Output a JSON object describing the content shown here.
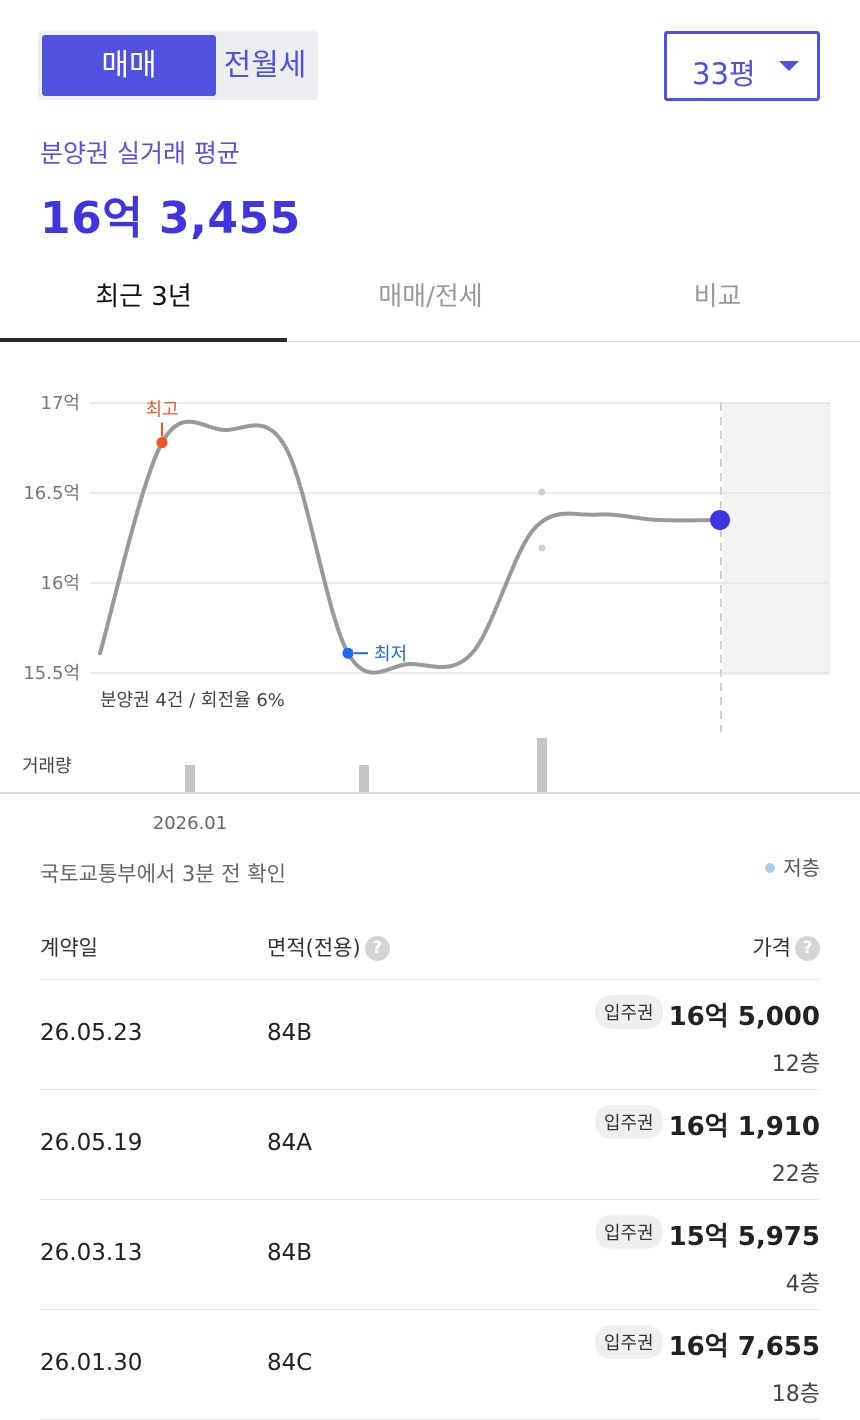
{
  "toggle": {
    "active": "매매",
    "inactive": "전월세"
  },
  "area_select": {
    "value": "33평"
  },
  "summary": {
    "subtitle": "분양권 실거래 평균",
    "average_price": "16억 3,455"
  },
  "tabs": [
    {
      "label": "최근 3년",
      "selected": true
    },
    {
      "label": "매매/전세",
      "selected": false
    },
    {
      "label": "비교",
      "selected": false
    }
  ],
  "chart_data": {
    "type": "line",
    "y_ticks": [
      "17억",
      "16.5억",
      "16억",
      "15.5억"
    ],
    "ylim": [
      15.5,
      17
    ],
    "y_unit": "억",
    "x_tick_labels": [
      "2026.01"
    ],
    "series": [
      {
        "points": [
          [
            0,
            15.61
          ],
          [
            1,
            16.78
          ],
          [
            2,
            16.85
          ],
          [
            3,
            16.75
          ],
          [
            4,
            15.61
          ],
          [
            5,
            15.55
          ],
          [
            6,
            15.61
          ],
          [
            7,
            16.3
          ],
          [
            8,
            16.38
          ],
          [
            9,
            16.35
          ],
          [
            10,
            16.35
          ]
        ]
      }
    ],
    "max_label": "최고",
    "max_value": 16.78,
    "min_label": "최저",
    "min_value": 15.61,
    "current_value": 16.35,
    "note": "분양권 4건 / 회전율 6%",
    "volume_label": "거래량",
    "volume": [
      1,
      1,
      2
    ],
    "colors": {
      "line": "#999999",
      "max": "#f0561e",
      "min": "#1f67e8",
      "current": "#3f35e0"
    }
  },
  "source_text": "국토교통부에서 3분 전 확인",
  "legend_text": "저층",
  "table": {
    "headers": {
      "date": "계약일",
      "area": "면적(전용)",
      "price": "가격"
    },
    "help_icon": "?",
    "rows": [
      {
        "date": "26.05.23",
        "area": "84B",
        "badge": "입주권",
        "price": "16억 5,000",
        "floor": "12층"
      },
      {
        "date": "26.05.19",
        "area": "84A",
        "badge": "입주권",
        "price": "16억 1,910",
        "floor": "22층"
      },
      {
        "date": "26.03.13",
        "area": "84B",
        "badge": "입주권",
        "price": "15억 5,975",
        "floor": "4층"
      },
      {
        "date": "26.01.30",
        "area": "84C",
        "badge": "입주권",
        "price": "16억 7,655",
        "floor": "18층"
      }
    ]
  }
}
